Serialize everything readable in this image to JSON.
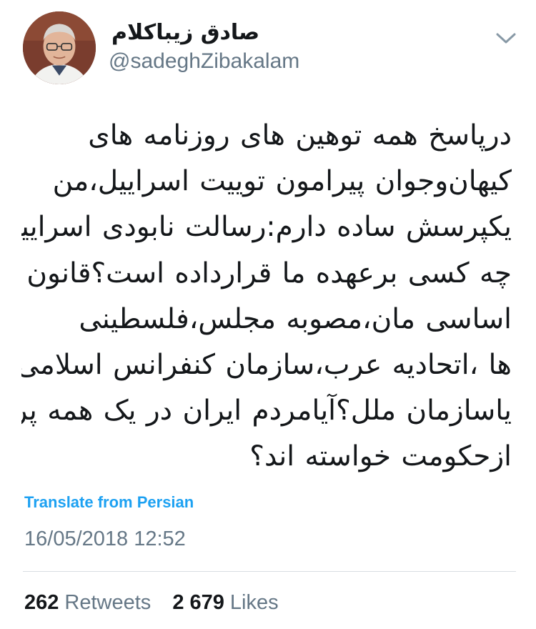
{
  "author": {
    "display_name": "صادق زیباکلام",
    "handle": "@sadeghZibakalam"
  },
  "tweet": {
    "lines": [
      "درپاسخ همه توهین های روزنامه های",
      "کیهان‌وجوان پیرامون توییت اسراییل،من",
      "یکپرسش ساده دارم:رسالت نابودی اسراییل را",
      "چه کسی برعهده ما قرارداده است؟قانون",
      "اساسی مان،مصوبه مجلس،فلسطینی",
      "ها ،اتحادیه عرب،سازمان کنفرانس اسلامی",
      "یاسازمان ملل؟آیامردم ایران در یک همه پرسی",
      "ازحکومت خواسته اند؟"
    ],
    "translate_label": "Translate from Persian",
    "timestamp": "16/05/2018 12:52"
  },
  "stats": {
    "retweets_count": "262",
    "retweets_label": "Retweets",
    "likes_count": "2 679",
    "likes_label": "Likes"
  },
  "icons": {
    "menu": "chevron-down-icon"
  },
  "colors": {
    "link": "#1da1f2",
    "secondary_text": "#657786",
    "primary_text": "#14171a",
    "divider": "#d8dee3"
  }
}
